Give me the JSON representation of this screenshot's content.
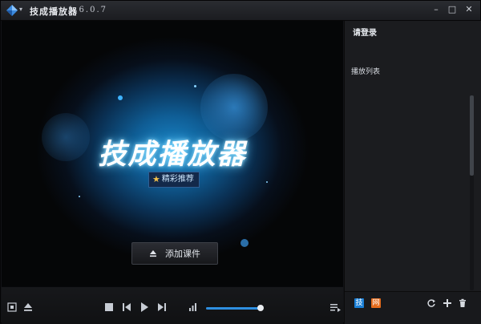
{
  "window": {
    "title": "技成播放器",
    "version": "1.6.0.7",
    "minimize_glyph": "–",
    "maximize_glyph": "□",
    "close_glyph": "✕"
  },
  "icons": {
    "logo": "diamond-logo-icon",
    "menu": "chevron-down-icon"
  },
  "video": {
    "brand_title": "技成播放器",
    "badge_text": "精彩推荐",
    "add_button_label": "添加课件"
  },
  "controls": {
    "volume_level": 0.97
  },
  "panel": {
    "login_label": "请登录",
    "playlist_title": "播放列表"
  },
  "footer_icons": {
    "app_one_glyph": "技",
    "app_two_glyph": "网"
  },
  "colors": {
    "accent": "#2e8fe0",
    "badge_star": "#f2c14b",
    "glow": "#6fd3ff"
  }
}
